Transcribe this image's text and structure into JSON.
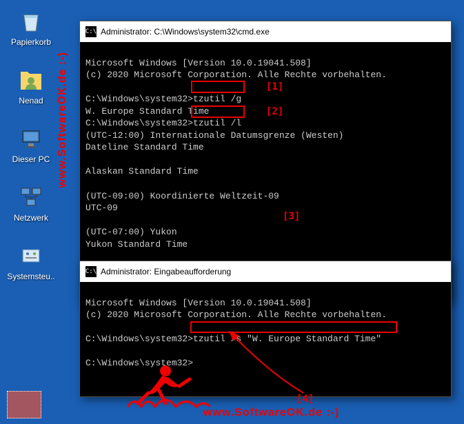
{
  "desktop": {
    "icons": [
      {
        "label": "Papierkorb",
        "name": "recycle-bin"
      },
      {
        "label": "Nenad",
        "name": "user-folder"
      },
      {
        "label": "Dieser PC",
        "name": "this-pc"
      },
      {
        "label": "Netzwerk",
        "name": "network"
      },
      {
        "label": "Systemsteu..",
        "name": "control-panel"
      }
    ]
  },
  "window1": {
    "title": "Administrator: C:\\Windows\\system32\\cmd.exe",
    "lines": {
      "l0": "Microsoft Windows [Version 10.0.19041.508]",
      "l1": "(c) 2020 Microsoft Corporation. Alle Rechte vorbehalten.",
      "l2": "",
      "l3": "C:\\Windows\\system32>tzutil /g",
      "l4": "W. Europe Standard Time",
      "l5": "C:\\Windows\\system32>tzutil /l",
      "l6": "(UTC-12:00) Internationale Datumsgrenze (Westen)",
      "l7": "Dateline Standard Time",
      "l8": "",
      "l9": "Alaskan Standard Time",
      "l10": "",
      "l11": "(UTC-09:00) Koordinierte Weltzeit-09",
      "l12": "UTC-09",
      "l13": "",
      "l14": "(UTC-07:00) Yukon",
      "l15": "Yukon Standard Time"
    }
  },
  "window2": {
    "title": "Administrator: Eingabeaufforderung",
    "lines": {
      "l0": "Microsoft Windows [Version 10.0.19041.508]",
      "l1": "(c) 2020 Microsoft Corporation. Alle Rechte vorbehalten.",
      "l2": "",
      "l3": "C:\\Windows\\system32>tzutil /s \"W. Europe Standard Time\"",
      "l4": "",
      "l5": "C:\\Windows\\system32>"
    }
  },
  "annotations": {
    "a1": "[1]",
    "a2": "[2]",
    "a3": "[3]",
    "a4": "[4]"
  },
  "watermark": "www.SoftwareOK.de :-)",
  "watermark_bottom": "www.SoftwareOK.de :-)"
}
